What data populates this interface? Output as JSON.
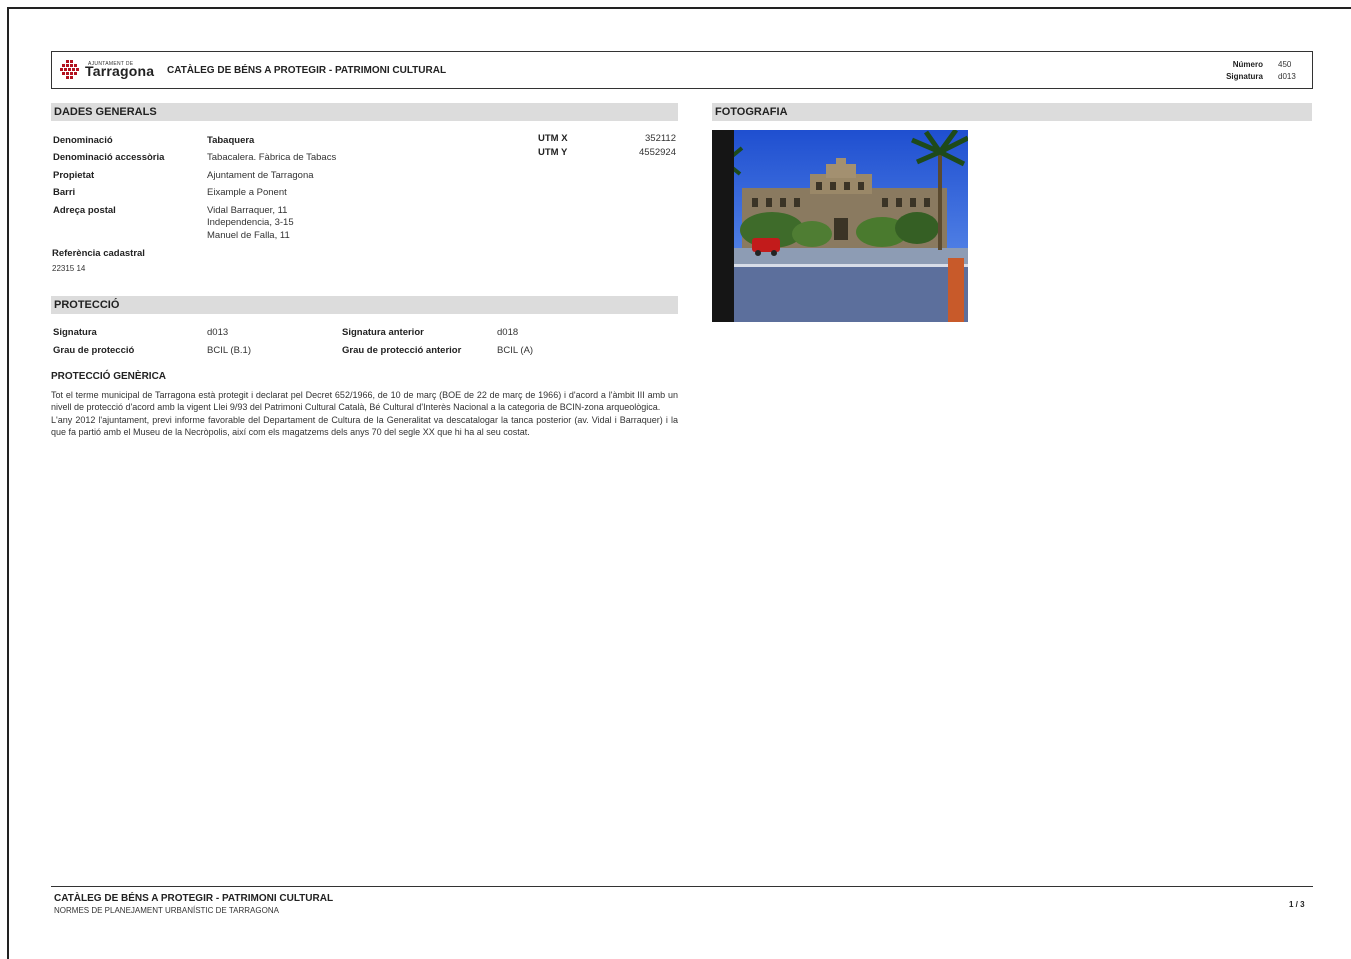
{
  "header": {
    "logo_top": "AJUNTAMENT DE",
    "logo_name": "Tarragona",
    "title": "CATÀLEG DE BÉNS A PROTEGIR - PATRIMONI CULTURAL",
    "numero_label": "Número",
    "numero_value": "450",
    "signatura_label": "Signatura",
    "signatura_value": "d013"
  },
  "dades_generals": {
    "title": "DADES GENERALS",
    "denominacio_label": "Denominació",
    "denominacio_value": "Tabaquera",
    "denominacio_accessoria_label": "Denominació accessòria",
    "denominacio_accessoria_value": "Tabacalera. Fàbrica de Tabacs",
    "propietat_label": "Propietat",
    "propietat_value": "Ajuntament de Tarragona",
    "barri_label": "Barri",
    "barri_value": "Eixample a Ponent",
    "adreca_label": "Adreça postal",
    "adreca_lines": [
      "Vidal Barraquer, 11",
      "Independencia, 3-15",
      "Manuel de Falla, 11"
    ],
    "referencia_label": "Referència cadastral",
    "referencia_value": "22315 14",
    "utm_x_label": "UTM X",
    "utm_x_value": "352112",
    "utm_y_label": "UTM Y",
    "utm_y_value": "4552924"
  },
  "fotografia": {
    "title": "FOTOGRAFIA"
  },
  "proteccio": {
    "title": "PROTECCIÓ",
    "signatura_label": "Signatura",
    "signatura_value": "d013",
    "signatura_anterior_label": "Signatura anterior",
    "signatura_anterior_value": "d018",
    "grau_label": "Grau de protecció",
    "grau_value": "BCIL (B.1)",
    "grau_anterior_label": "Grau de protecció anterior",
    "grau_anterior_value": "BCIL (A)",
    "generica_title": "PROTECCIÓ GENÈRICA",
    "generica_paragraphs": [
      "Tot el terme municipal de Tarragona està protegit i declarat pel Decret 652/1966, de 10 de març (BOE de 22 de març de 1966) i d'acord a l'àmbit III amb un nivell de protecció d'acord amb la vigent Llei 9/93 del Patrimoni Cultural Català, Bé Cultural d'Interès Nacional a la categoria de BCIN-zona arqueològica.",
      "L'any 2012 l'ajuntament, previ informe favorable del Departament de Cultura de la Generalitat va descatalogar la tanca posterior (av. Vidal i Barraquer) i la que fa partió amb el Museu de la Necròpolis, així com els magatzems dels anys 70 del segle XX que hi ha al seu costat."
    ]
  },
  "footer": {
    "title": "CATÀLEG DE BÉNS A PROTEGIR - PATRIMONI CULTURAL",
    "subtitle": "NORMES DE PLANEJAMENT URBANÍSTIC DE TARRAGONA",
    "page": "1 / 3"
  },
  "colors": {
    "section_bar": "#dcdcdc",
    "logo_red": "#b3121f"
  }
}
